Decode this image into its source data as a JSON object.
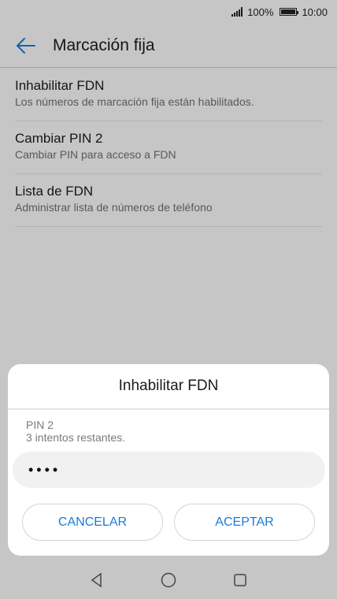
{
  "status_bar": {
    "battery": "100%",
    "time": "10:00"
  },
  "app_bar": {
    "title": "Marcación fija"
  },
  "settings": [
    {
      "title": "Inhabilitar FDN",
      "summary": "Los números de marcación fija están habilitados."
    },
    {
      "title": "Cambiar PIN 2",
      "summary": "Cambiar PIN para acceso a FDN"
    },
    {
      "title": "Lista de FDN",
      "summary": "Administrar lista de números de teléfono"
    }
  ],
  "dialog": {
    "title": "Inhabilitar FDN",
    "field_label": "PIN 2",
    "attempts_hint": "3 intentos restantes.",
    "pin_value": "••••",
    "cancel_label": "CANCELAR",
    "accept_label": "ACEPTAR"
  },
  "colors": {
    "accent": "#1a7ad8"
  },
  "nav_icons": [
    "back-triangle-icon",
    "home-circle-icon",
    "recents-square-icon"
  ]
}
